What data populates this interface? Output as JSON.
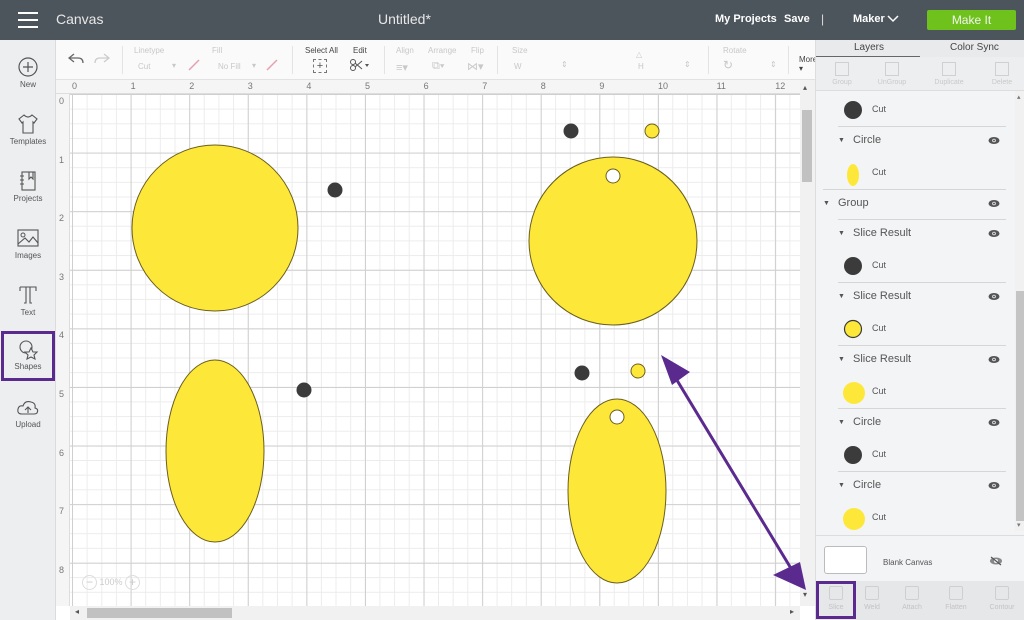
{
  "topbar": {
    "app_title": "Canvas",
    "doc_title": "Untitled*",
    "my_projects": "My Projects",
    "save": "Save",
    "separator": "|",
    "machine": "Maker",
    "make_it": "Make It"
  },
  "leftbar": {
    "items": [
      {
        "label": "New",
        "icon": "plus-circle-icon"
      },
      {
        "label": "Templates",
        "icon": "tshirt-icon"
      },
      {
        "label": "Projects",
        "icon": "notebook-icon"
      },
      {
        "label": "Images",
        "icon": "image-icon"
      },
      {
        "label": "Text",
        "icon": "text-t-icon"
      },
      {
        "label": "Shapes",
        "icon": "shapes-icon",
        "active": true
      },
      {
        "label": "Upload",
        "icon": "cloud-upload-icon"
      }
    ]
  },
  "toolbar": {
    "linetype_label": "Linetype",
    "linetype_value": "Cut",
    "fill_label": "Fill",
    "fill_value": "No Fill",
    "select_all": "Select All",
    "edit": "Edit",
    "align": "Align",
    "arrange": "Arrange",
    "flip": "Flip",
    "size": "Size",
    "w": "W",
    "h": "H",
    "rotate": "Rotate",
    "more": "More ▾"
  },
  "canvas": {
    "ruler_top": [
      "0",
      "1",
      "2",
      "3",
      "4",
      "5",
      "6",
      "7",
      "8",
      "9",
      "10",
      "11",
      "12"
    ],
    "ruler_left": [
      "0",
      "1",
      "2",
      "3",
      "4",
      "5",
      "6",
      "7",
      "8"
    ],
    "zoom_level": "100%",
    "colors": {
      "yellow": "#fde83a",
      "dark": "#3b3b3b",
      "outline": "#6b5e1e"
    }
  },
  "annotation": {
    "color": "#5b2a8f"
  },
  "right_panel": {
    "tabs": [
      "Layers",
      "Color Sync"
    ],
    "actions": [
      "Group",
      "UnGroup",
      "Duplicate",
      "Delete"
    ],
    "layers": [
      {
        "type": "sub",
        "swatch": "dark-circle",
        "label": "Cut"
      },
      {
        "type": "head",
        "indent": 1,
        "name": "Circle"
      },
      {
        "type": "sub",
        "swatch": "yellow-oval",
        "label": "Cut"
      },
      {
        "type": "head",
        "indent": 0,
        "name": "Group"
      },
      {
        "type": "head",
        "indent": 1,
        "name": "Slice Result"
      },
      {
        "type": "sub",
        "swatch": "dark-circle",
        "label": "Cut"
      },
      {
        "type": "head",
        "indent": 1,
        "name": "Slice Result"
      },
      {
        "type": "sub",
        "swatch": "yellow-ring",
        "label": "Cut"
      },
      {
        "type": "head",
        "indent": 1,
        "name": "Slice Result"
      },
      {
        "type": "sub",
        "swatch": "yellow-circle",
        "label": "Cut"
      },
      {
        "type": "head",
        "indent": 1,
        "name": "Circle"
      },
      {
        "type": "sub",
        "swatch": "dark-circle",
        "label": "Cut"
      },
      {
        "type": "head",
        "indent": 1,
        "name": "Circle"
      },
      {
        "type": "sub",
        "swatch": "yellow-circle",
        "label": "Cut"
      }
    ],
    "blank_canvas": "Blank Canvas",
    "bottom_actions": [
      "Slice",
      "Weld",
      "Attach",
      "Flatten",
      "Contour"
    ]
  }
}
